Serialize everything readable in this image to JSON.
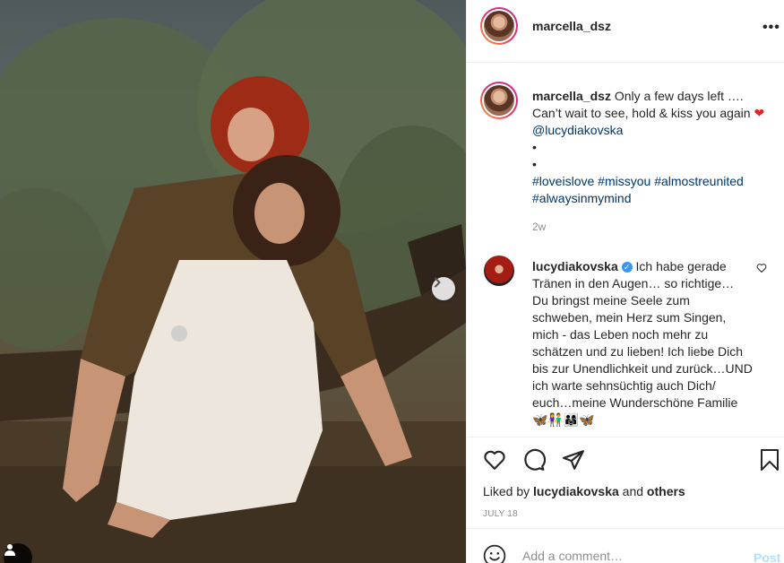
{
  "post": {
    "username": "marcella_dsz",
    "caption": {
      "text": "Only a few days left …. Can’t wait to see, hold & kiss you again",
      "heart_emoji": "❤",
      "mention": "@lucydiakovska",
      "bullet1": "•",
      "bullet2": "•",
      "hashtags": [
        "#loveislove",
        "#missyou",
        "#almostreunited",
        "#alwaysinmymind"
      ]
    },
    "time_ago": "2w"
  },
  "comment": {
    "username": "lucydiakovska",
    "verified_mark": "✓",
    "text": "Ich habe gerade Tränen in den Augen… so richtige… Du bringst meine Seele zum schweben, mein Herz sum Singen, mich - das Leben noch mehr zu schätzen und zu lieben! Ich liebe Dich bis zur Unendlichkeit und zurück…UND ich warte sehnsüchtig auch Dich/ euch…meine Wunderschöne Familie 🦋👫👨‍👩‍👧🦋"
  },
  "likes": {
    "prefix": "Liked by",
    "user": "lucydiakovska",
    "conjunction": "and",
    "others": "others"
  },
  "date": "JULY 18",
  "add_comment": {
    "placeholder": "Add a comment…",
    "post_label": "Post"
  },
  "colors": {
    "link": "#00376b",
    "heart": "#e02424",
    "post_disabled": "#b2dffc",
    "verified": "#3897f0"
  },
  "icons": [
    "more-options-icon",
    "heart-icon",
    "comment-icon",
    "share-icon",
    "bookmark-icon",
    "emoji-icon",
    "user-tag-icon",
    "chevron-right-icon",
    "verified-icon"
  ]
}
